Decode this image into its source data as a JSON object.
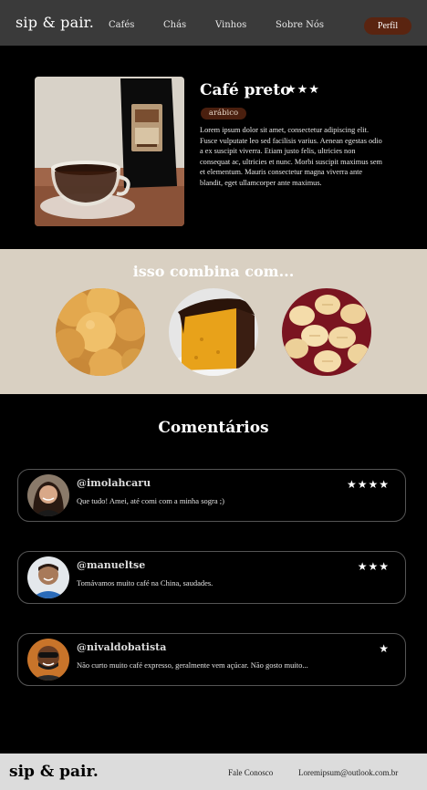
{
  "header": {
    "logo": "sip & pair.",
    "nav": [
      "Cafés",
      "Chás",
      "Vinhos",
      "Sobre Nós"
    ],
    "profile_label": "Perfil"
  },
  "product": {
    "title": "Café preto",
    "stars": "★★★",
    "badge": "arábico",
    "description": "Lorem ipsum dolor sit amet, consectetur adipiscing elit. Fusce vulputate leo sed facilisis varius. Aenean egestas odio a ex suscipit viverra. Etiam justo felis, ultricies non consequat ac, ultricies et nunc. Morbi suscipit maximus sem et elementum. Mauris consectetur magna viverra ante blandit, eget ullamcorper ante maximus.",
    "image_icon": "coffee-cup-photo"
  },
  "pairing": {
    "title": "isso combina com...",
    "items": [
      "pão de queijo",
      "bolo com cobertura de chocolate",
      "biscoitos"
    ]
  },
  "comments": {
    "title": "Comentários",
    "items": [
      {
        "handle": "@imolahcaru",
        "text": "Que tudo! Amei, até comi com a minha sogra ;)",
        "stars": "★★★★"
      },
      {
        "handle": "@manueltse",
        "text": "Tomávamos muito café na China, saudades.",
        "stars": "★★★"
      },
      {
        "handle": "@nivaldobatista",
        "text": "Não curto muito café  expresso, geralmente vem açúcar. Não gosto muito...",
        "stars": "★"
      }
    ]
  },
  "footer": {
    "logo": "sip & pair.",
    "contact": "Fale Conosco",
    "email": "Loremipsum@outlook.com.br"
  },
  "colors": {
    "accent": "#5a2410",
    "badge": "#4a1f0e",
    "pair_band": "#d9d0c2"
  }
}
